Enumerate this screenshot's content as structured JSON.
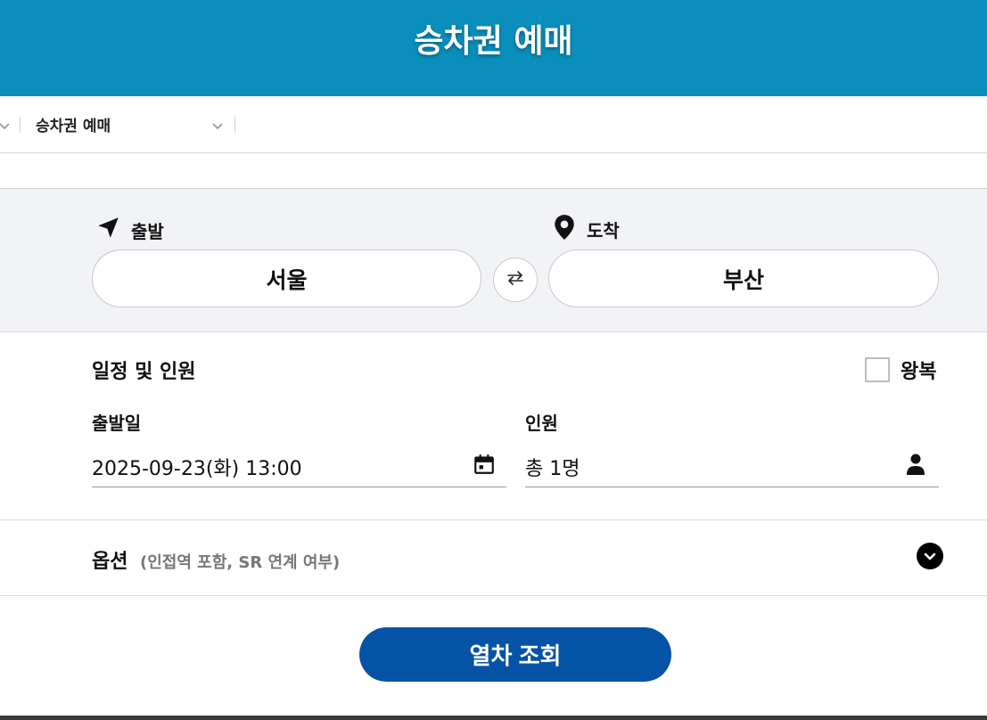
{
  "header": {
    "title": "승차권 예매"
  },
  "breadcrumb": {
    "current": "승차권 예매"
  },
  "route": {
    "departure_label": "출발",
    "departure_value": "서울",
    "arrival_label": "도착",
    "arrival_value": "부산"
  },
  "schedule": {
    "title": "일정 및 인원",
    "roundtrip_label": "왕복",
    "roundtrip_checked": false,
    "date_label": "출발일",
    "date_value": "2025-09-23(화) 13:00",
    "passenger_label": "인원",
    "passenger_value": "총 1명"
  },
  "options": {
    "title": "옵션",
    "subtitle": "(인접역 포함, SR 연계 여부)"
  },
  "search": {
    "label": "열차 조회"
  },
  "colors": {
    "header_bg": "#0a8fbc",
    "route_bg": "#f2f3f7",
    "primary_button": "#0553a6"
  },
  "icons": {
    "departure": "navigation-arrow-icon",
    "arrival": "map-pin-icon",
    "swap": "swap-arrows-icon",
    "date": "calendar-icon",
    "passenger": "person-icon",
    "options": "chevron-down-circle-icon"
  }
}
